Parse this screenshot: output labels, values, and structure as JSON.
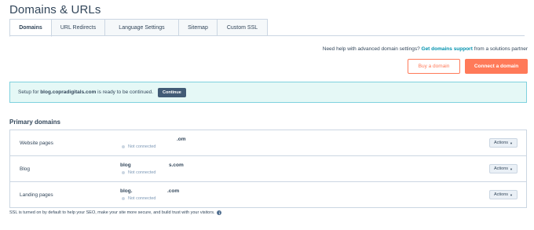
{
  "page": {
    "title": "Domains & URLs"
  },
  "tabs": [
    {
      "label": "Domains",
      "active": true
    },
    {
      "label": "URL Redirects"
    },
    {
      "label": "Language Settings"
    },
    {
      "label": "Sitemap"
    },
    {
      "label": "Custom SSL"
    }
  ],
  "help": {
    "prefix": "Need help with advanced domain settings?",
    "link": "Get domains support",
    "suffix": "from a solutions partner"
  },
  "buttons": {
    "buy_domain": "Buy a domain",
    "connect_domain": "Connect a domain"
  },
  "alert": {
    "prefix": "Setup for",
    "domain": "blog.copradigitals.com",
    "suffix": "is ready to be continued.",
    "continue_label": "Continue"
  },
  "primary_domains": {
    "heading": "Primary domains",
    "rows": [
      {
        "label": "Website pages",
        "domain_prefix": "",
        "domain_suffix": ".om",
        "status": "Not connected",
        "actions_label": "Actions"
      },
      {
        "label": "Blog",
        "domain_prefix": "blog",
        "domain_suffix": "s.com",
        "status": "Not connected",
        "actions_label": "Actions"
      },
      {
        "label": "Landing pages",
        "domain_prefix": "blog.",
        "domain_suffix": ".com",
        "status": "Not connected",
        "actions_label": "Actions"
      }
    ]
  },
  "footer": {
    "ssl_note": "SSL is turned on by default to help your SEO, make your site more secure, and build trust with your visitors."
  },
  "colors": {
    "accent": "#ff7a59",
    "link": "#0091ae",
    "alert_bg": "#e5f8f6",
    "alert_border": "#7fd1de",
    "text": "#33475b"
  }
}
